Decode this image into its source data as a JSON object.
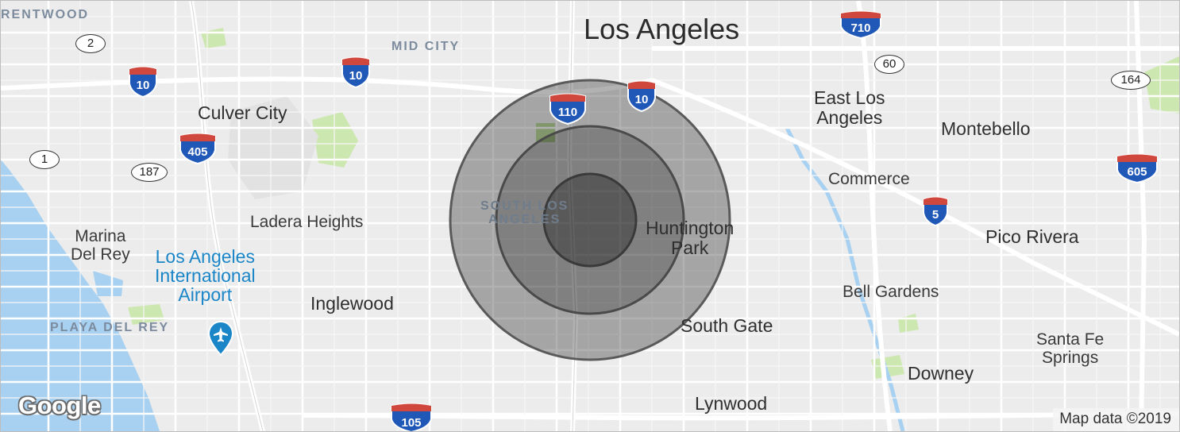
{
  "map": {
    "labels": {
      "brentwood": "RENTWOOD",
      "mid_city": "MID CITY",
      "los_angeles": "Los Angeles",
      "culver_city": "Culver City",
      "east_los_angeles_1": "East Los",
      "east_los_angeles_2": "Angeles",
      "montebello": "Montebello",
      "commerce": "Commerce",
      "ladera_heights": "Ladera Heights",
      "south_la_1": "SOUTH LOS",
      "south_la_2": "ANGELES",
      "huntington_park_1": "Huntington",
      "huntington_park_2": "Park",
      "pico_rivera": "Pico Rivera",
      "marina_1": "Marina",
      "marina_2": "Del Rey",
      "lax_1": "Los Angeles",
      "lax_2": "International",
      "lax_3": "Airport",
      "inglewood": "Inglewood",
      "bell_gardens": "Bell Gardens",
      "playa_del_rey": "PLAYA DEL REY",
      "south_gate": "South Gate",
      "santa_fe_1": "Santa Fe",
      "santa_fe_2": "Springs",
      "downey": "Downey",
      "lynwood": "Lynwood"
    },
    "shields": {
      "i10_a": "10",
      "i10_b": "10",
      "i10_c": "10",
      "i405": "405",
      "i110": "110",
      "i710": "710",
      "i5": "5",
      "i605": "605",
      "i105": "105"
    },
    "routes": {
      "r2": "2",
      "r1": "1",
      "r187": "187",
      "r60": "60",
      "r164": "164"
    },
    "logo": "Google",
    "attribution": "Map data ©2019",
    "radius_rings": 3,
    "colors": {
      "land": "#ececec",
      "water": "#a8d1f1",
      "park": "#cde7b0",
      "road": "#ffffff",
      "ring_fill": "#000000",
      "interstate_blue": "#2058b8",
      "interstate_red": "#d0473d",
      "airport": "#1a86c8"
    }
  }
}
